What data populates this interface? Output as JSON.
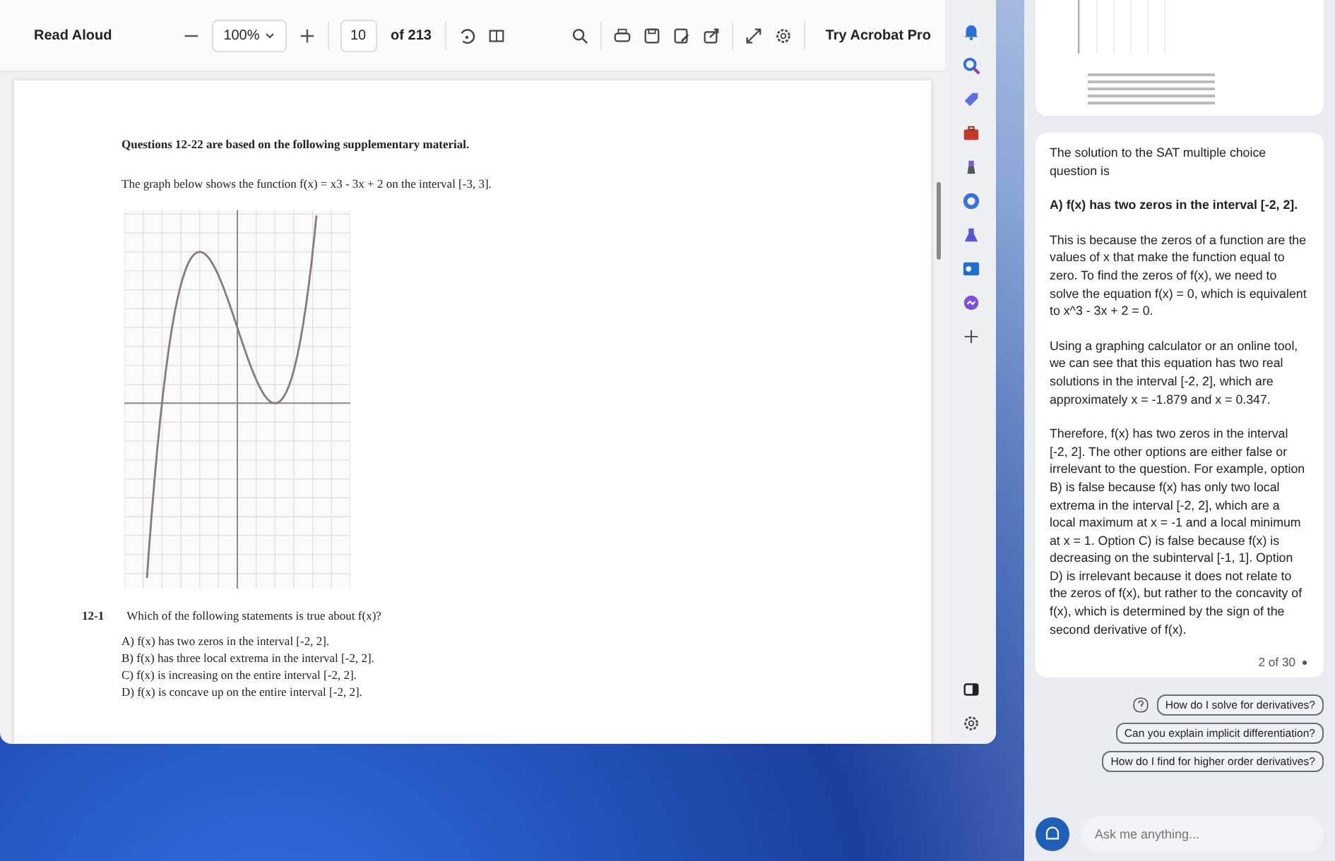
{
  "toolbar": {
    "read_aloud": "Read Aloud",
    "zoom": "100%",
    "page": "10",
    "page_count": "of 213",
    "upgrade": "Try Acrobat Pro"
  },
  "document": {
    "heading": "Questions 12-22 are based on the following supplementary material.",
    "intro": "The graph below shows the function f(x) = x3 - 3x + 2 on the interval [-3, 3].",
    "question_number": "12-1",
    "question": "Which of the following statements is true about f(x)?",
    "options": [
      "A) f(x) has two zeros in the interval [-2, 2].",
      "B) f(x) has three local extrema in the interval [-2, 2].",
      "C) f(x) is increasing on the entire interval [-2, 2].",
      "D) f(x) is concave up on the entire interval [-2, 2]."
    ]
  },
  "copilot": {
    "messages": [
      {
        "kind": "text",
        "text": "The solution to the SAT multiple choice question is"
      },
      {
        "kind": "answer",
        "text": "A) f(x) has two zeros in the interval [-2, 2]."
      },
      {
        "kind": "text",
        "text": "This is because the zeros of a function are the values of x that make the function equal to zero. To find the zeros of f(x), we need to solve the equation f(x) = 0, which is equivalent to x^3 - 3x + 2 = 0."
      },
      {
        "kind": "text",
        "text": "Using a graphing calculator or an online tool, we can see that this equation has two real solutions in the interval [-2, 2], which are approximately x = -1.879 and x = 0.347."
      },
      {
        "kind": "text",
        "text": "Therefore, f(x) has two zeros in the interval [-2, 2]. The other options are either false or irrelevant to the question. For example, option B) is false because f(x) has only two local extrema in the interval [-2, 2], which are a local maximum at x = -1 and a local minimum at x = 1. Option C) is false because f(x) is decreasing on the subinterval [-1, 1]. Option D) is irrelevant because it does not relate to the zeros of f(x), but rather to the concavity of f(x), which is determined by the sign of the second derivative of f(x)."
      }
    ],
    "counter": "2 of 30",
    "suggestions": [
      "How do I solve for derivatives?",
      "Can you explain implicit differentiation?",
      "How do I find for higher order derivatives?"
    ],
    "input": {
      "placeholder": "Ask me anything..."
    }
  }
}
